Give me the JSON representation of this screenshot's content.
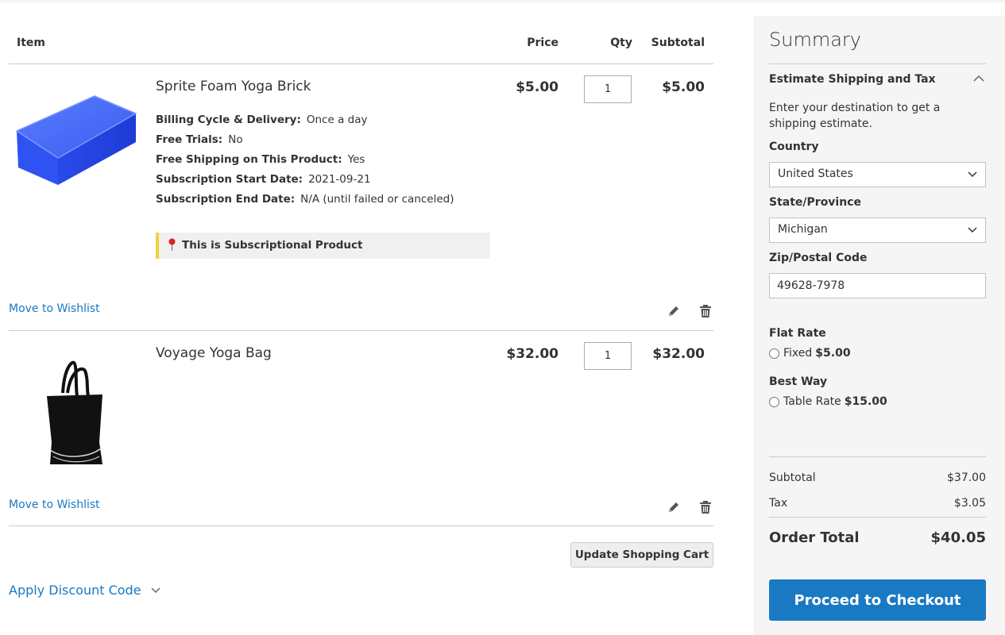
{
  "cart": {
    "headers": {
      "item": "Item",
      "price": "Price",
      "qty": "Qty",
      "subtotal": "Subtotal"
    },
    "items": [
      {
        "name": "Sprite Foam Yoga Brick",
        "price": "$5.00",
        "qty": "1",
        "subtotal": "$5.00",
        "image_icon": "blue-yoga-brick-image",
        "options": [
          {
            "label": "Billing Cycle & Delivery:",
            "value": "Once a day"
          },
          {
            "label": "Free Trials:",
            "value": "No"
          },
          {
            "label": "Free Shipping on This Product:",
            "value": "Yes"
          },
          {
            "label": "Subscription Start Date:",
            "value": "2021-09-21"
          },
          {
            "label": "Subscription End Date:",
            "value": "N/A (until failed or canceled)"
          }
        ],
        "notice": "This is Subscriptional Product",
        "wishlist_label": "Move to Wishlist"
      },
      {
        "name": "Voyage Yoga Bag",
        "price": "$32.00",
        "qty": "1",
        "subtotal": "$32.00",
        "image_icon": "black-tote-bag-image",
        "wishlist_label": "Move to Wishlist"
      }
    ],
    "update_button": "Update Shopping Cart",
    "discount_label": "Apply Discount Code"
  },
  "summary": {
    "title": "Summary",
    "estimate_title": "Estimate Shipping and Tax",
    "estimate_desc": "Enter your destination to get a shipping estimate.",
    "country_label": "Country",
    "country_value": "United States",
    "state_label": "State/Province",
    "state_value": "Michigan",
    "zip_label": "Zip/Postal Code",
    "zip_value": "49628-7978",
    "rates": [
      {
        "group": "Flat Rate",
        "option": "Fixed",
        "price": "$5.00"
      },
      {
        "group": "Best Way",
        "option": "Table Rate",
        "price": "$15.00"
      }
    ],
    "subtotal_label": "Subtotal",
    "subtotal_value": "$37.00",
    "tax_label": "Tax",
    "tax_value": "$3.05",
    "order_total_label": "Order Total",
    "order_total_value": "$40.05",
    "checkout_button": "Proceed to Checkout"
  },
  "colors": {
    "link": "#1979c3",
    "checkout_button": "#1979c3",
    "notice_accent": "#f3d13a",
    "summary_background": "#f5f5f5"
  }
}
